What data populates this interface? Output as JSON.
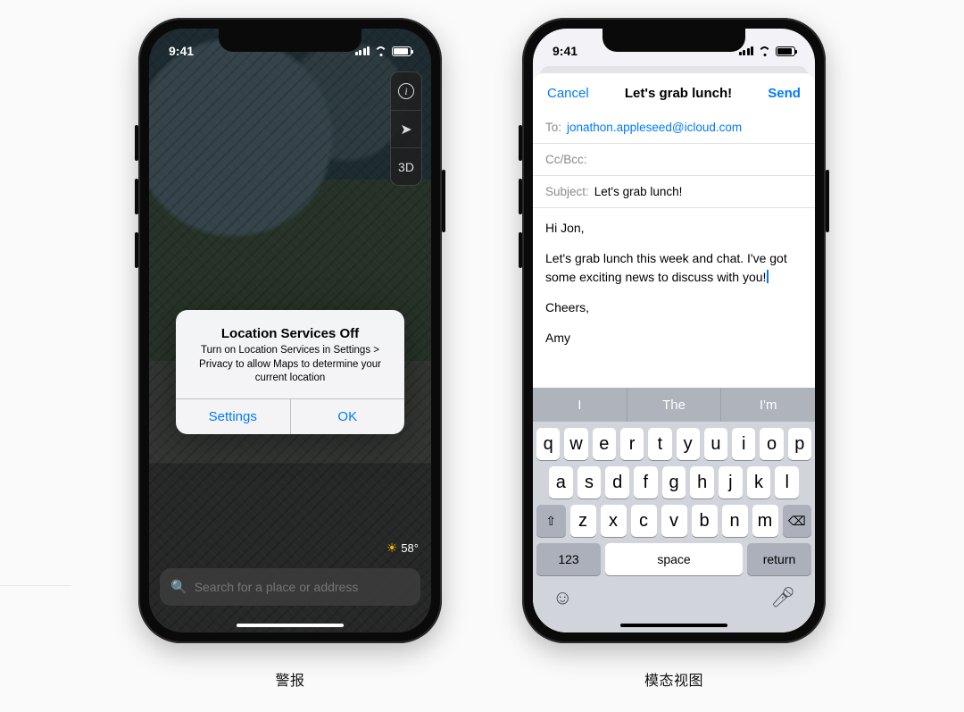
{
  "status": {
    "time": "9:41"
  },
  "captions": {
    "left": "警报",
    "right": "模态视图"
  },
  "maps": {
    "controls": {
      "info": "i",
      "threeD": "3D"
    },
    "weather": {
      "temp": "58°"
    },
    "search": {
      "placeholder": "Search for a place or address"
    },
    "alert": {
      "title": "Location Services Off",
      "message": "Turn on Location Services in Settings > Privacy to allow Maps to determine your current location",
      "settings": "Settings",
      "ok": "OK"
    }
  },
  "mail": {
    "header": {
      "cancel": "Cancel",
      "title": "Let's grab lunch!",
      "send": "Send"
    },
    "fields": {
      "toLabel": "To:",
      "toValue": "jonathon.appleseed@icloud.com",
      "ccLabel": "Cc/Bcc:",
      "subjectLabel": "Subject:",
      "subjectValue": "Let's grab lunch!"
    },
    "body": {
      "p1": "Hi Jon,",
      "p2": "Let's grab lunch this week and chat. I've got some exciting news to discuss with you!",
      "p3": "Cheers,",
      "p4": "Amy"
    },
    "keyboard": {
      "suggestions": [
        "I",
        "The",
        "I'm"
      ],
      "row1": [
        "q",
        "w",
        "e",
        "r",
        "t",
        "y",
        "u",
        "i",
        "o",
        "p"
      ],
      "row2": [
        "a",
        "s",
        "d",
        "f",
        "g",
        "h",
        "j",
        "k",
        "l"
      ],
      "row3": [
        "z",
        "x",
        "c",
        "v",
        "b",
        "n",
        "m"
      ],
      "numbers": "123",
      "space": "space",
      "ret": "return"
    }
  }
}
